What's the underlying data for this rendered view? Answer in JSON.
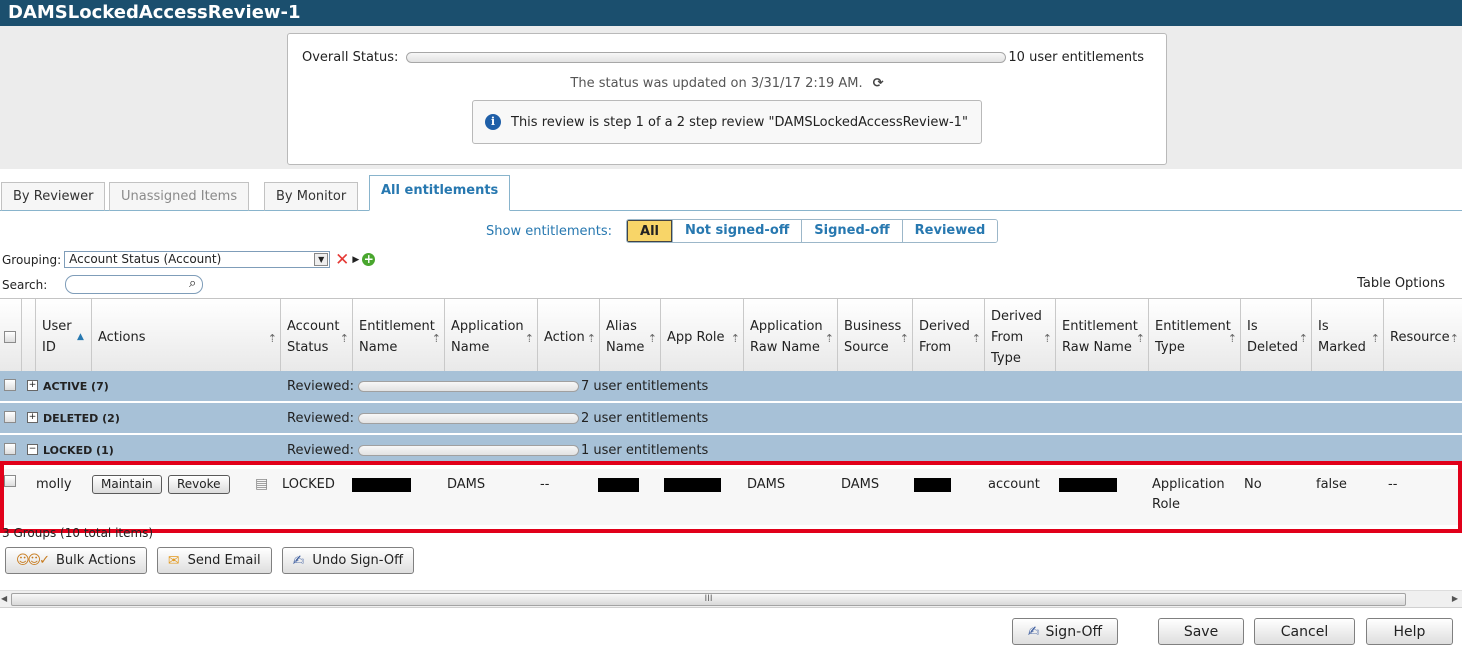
{
  "window": {
    "title": "DAMSLockedAccessReview-1"
  },
  "status": {
    "label": "Overall Status:",
    "count_text": "10 user entitlements",
    "progress_fraction": 0.0,
    "updated_text": "The status was updated on 3/31/17 2:19 AM.",
    "info_text": "This review is step 1 of a 2 step review \"DAMSLockedAccessReview-1\""
  },
  "tabs": [
    {
      "label": "By Reviewer"
    },
    {
      "label": "Unassigned Items"
    },
    {
      "label": "By Monitor"
    },
    {
      "label": "All entitlements"
    }
  ],
  "filter": {
    "label": "Show entitlements:",
    "options": [
      "All",
      "Not signed-off",
      "Signed-off",
      "Reviewed"
    ],
    "selected": "All"
  },
  "grouping": {
    "label": "Grouping:",
    "value": "Account Status (Account)"
  },
  "search": {
    "label": "Search:",
    "placeholder": ""
  },
  "table_options": "Table Options",
  "columns": [
    "User ID",
    "Actions",
    "Account Status",
    "Entitlement Name",
    "Application Name",
    "Action",
    "Alias Name",
    "App Role",
    "Application Raw Name",
    "Business Source",
    "Derived From",
    "Derived From Type",
    "Entitlement Raw Name",
    "Entitlement Type",
    "Is Deleted",
    "Is Marked",
    "Resource"
  ],
  "groups": [
    {
      "name": "ACTIVE (7)",
      "expander": "+",
      "reviewed_label": "Reviewed:",
      "count_text": "7 user entitlements"
    },
    {
      "name": "DELETED (2)",
      "expander": "+",
      "reviewed_label": "Reviewed:",
      "count_text": "2 user entitlements"
    },
    {
      "name": "LOCKED (1)",
      "expander": "−",
      "reviewed_label": "Reviewed:",
      "count_text": "1 user entitlements"
    }
  ],
  "row": {
    "user_id": "molly",
    "maintain_label": "Maintain",
    "revoke_label": "Revoke",
    "account_status": "LOCKED",
    "application_name": "DAMS",
    "action": "--",
    "application_raw_name": "DAMS",
    "business_source": "DAMS",
    "derived_from_type": "account",
    "entitlement_type": "Application Role",
    "is_deleted": "No",
    "is_marked": "false",
    "resource": "--"
  },
  "footer": {
    "groups_text": "3 Groups (10 total items)",
    "bulk_actions": "Bulk Actions",
    "send_email": "Send Email",
    "undo_signoff": "Undo Sign-Off"
  },
  "scrollbar_grip": "III",
  "bottom": {
    "signoff": "Sign-Off",
    "save": "Save",
    "cancel": "Cancel",
    "help": "Help"
  },
  "colors": {
    "titlebar": "#1b4f6e",
    "group_row": "#a7c1d7",
    "tab_active": "#2778b0",
    "highlight": "#e1001a",
    "selected_filter": "#f8d568"
  }
}
